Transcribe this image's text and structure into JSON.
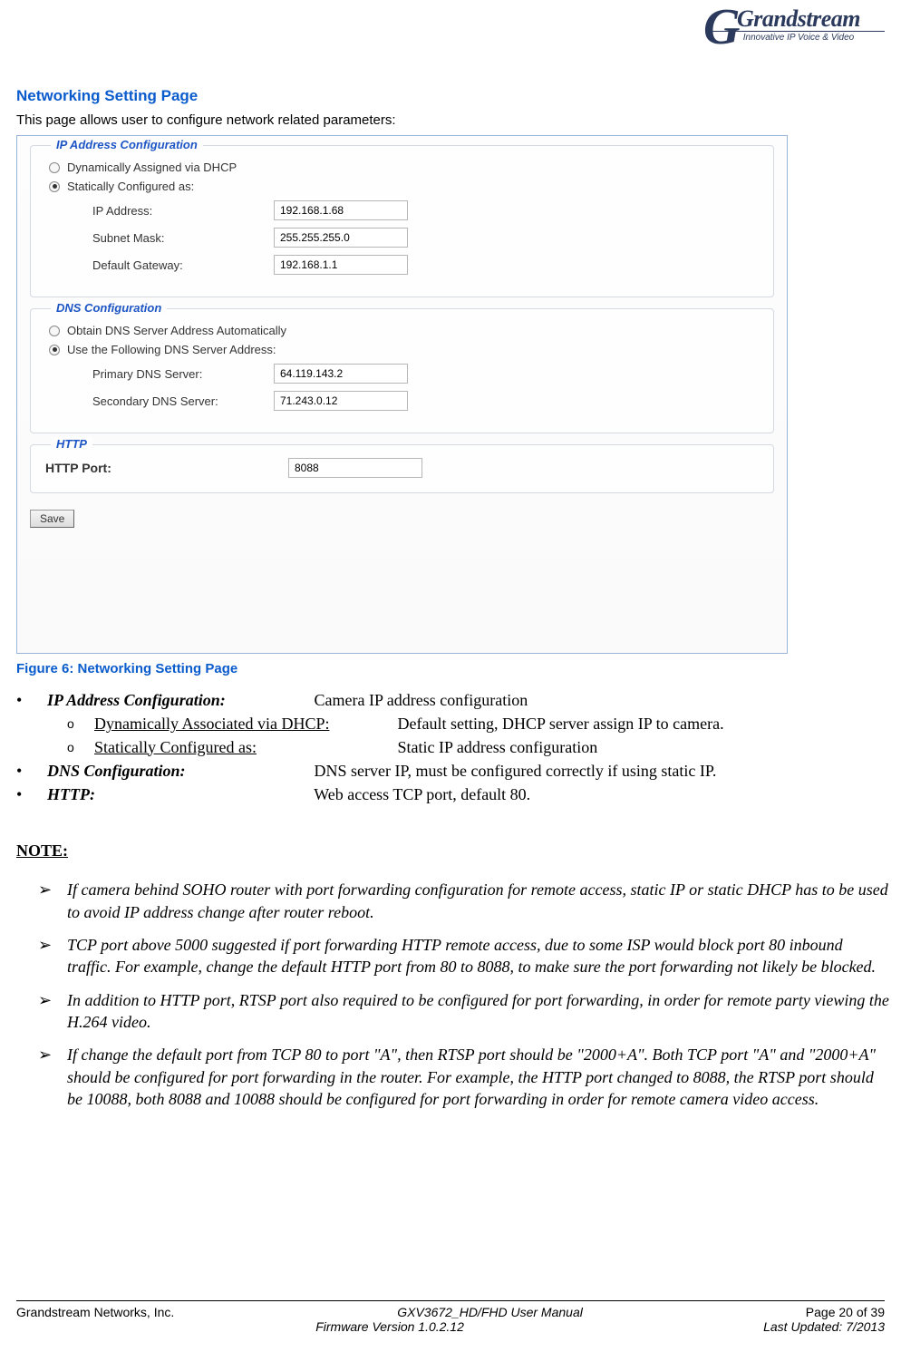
{
  "logo": {
    "main": "Grandstream",
    "tagline": "Innovative IP Voice & Video"
  },
  "heading": "Networking Setting Page",
  "intro": "This page allows user to configure network related parameters:",
  "screenshot": {
    "ip": {
      "title": "IP Address Configuration",
      "opt_dhcp": "Dynamically Assigned via DHCP",
      "opt_static": "Statically Configured as:",
      "ip_label": "IP Address:",
      "ip_value": "192.168.1.68",
      "subnet_label": "Subnet Mask:",
      "subnet_value": "255.255.255.0",
      "gw_label": "Default Gateway:",
      "gw_value": "192.168.1.1"
    },
    "dns": {
      "title": "DNS Configuration",
      "opt_auto": "Obtain DNS Server Address Automatically",
      "opt_manual": "Use the Following DNS Server Address:",
      "primary_label": "Primary DNS Server:",
      "primary_value": "64.119.143.2",
      "secondary_label": "Secondary DNS Server:",
      "secondary_value": "71.243.0.12"
    },
    "http": {
      "title": "HTTP",
      "port_label": "HTTP Port:",
      "port_value": "8088"
    },
    "save": "Save"
  },
  "figure_caption": "Figure 6:  Networking Setting Page",
  "bullets": {
    "ip_term": "IP Address Configuration:",
    "ip_desc": "Camera IP address configuration",
    "dhcp_term": "Dynamically Associated via DHCP:",
    "dhcp_desc": "Default setting, DHCP server assign IP to camera.",
    "static_term": "Statically Configured as: ",
    "static_desc": "Static IP address configuration",
    "dns_term": "DNS Configuration:",
    "dns_desc": "DNS server IP, must be configured correctly if using static IP.",
    "http_term": "HTTP:",
    "http_desc": "Web access TCP port, default 80."
  },
  "note_title": "NOTE:",
  "notes": {
    "n1": "If camera behind SOHO router with port forwarding configuration for remote access, static IP or static DHCP has to be used to avoid IP address change after router reboot.",
    "n2": "TCP port above 5000 suggested if port forwarding HTTP remote access, due to some ISP would block port 80 inbound traffic. For example, change the default HTTP port from 80 to 8088, to make sure the port forwarding not likely be blocked.",
    "n3": " In addition to HTTP port, RTSP port also required to be configured for port forwarding, in order for remote party viewing the H.264 video.",
    "n4": "If change the default port from TCP 80 to port \"A\", then RTSP port should be \"2000+A\". Both TCP port \"A\" and \"2000+A\" should be configured for port forwarding in the router. For example, the HTTP port changed to 8088, the RTSP port should be 10088, both 8088 and 10088 should be configured for port forwarding in order for remote camera video access."
  },
  "footer": {
    "company": "Grandstream Networks, Inc.",
    "manual": "GXV3672_HD/FHD User Manual",
    "firmware": "Firmware Version 1.0.2.12",
    "page": "Page 20 of 39",
    "updated": "Last Updated: 7/2013"
  }
}
